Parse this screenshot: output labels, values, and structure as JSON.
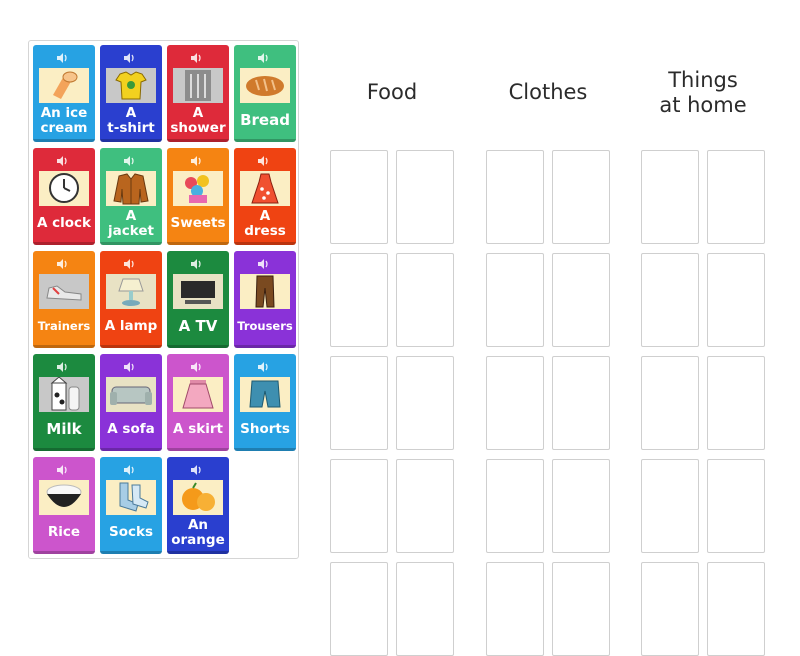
{
  "tray": {
    "cards": [
      {
        "label": "An ice\ncream",
        "color": "#27a2e3",
        "icon": "ice-cream-icon",
        "size": "normal"
      },
      {
        "label": "A\nt-shirt",
        "color": "#2a3fcf",
        "icon": "t-shirt-icon",
        "size": "normal"
      },
      {
        "label": "A\nshower",
        "color": "#de2a3a",
        "icon": "shower-icon",
        "size": "normal"
      },
      {
        "label": "Bread",
        "color": "#3fbf7f",
        "icon": "bread-icon",
        "size": "big"
      },
      {
        "label": "A clock",
        "color": "#de2a3a",
        "icon": "clock-icon",
        "size": "normal"
      },
      {
        "label": "A\njacket",
        "color": "#3fbf7f",
        "icon": "jacket-icon",
        "size": "normal"
      },
      {
        "label": "Sweets",
        "color": "#f58412",
        "icon": "sweets-icon",
        "size": "normal"
      },
      {
        "label": "A\ndress",
        "color": "#ef4312",
        "icon": "dress-icon",
        "size": "normal"
      },
      {
        "label": "Trainers",
        "color": "#f58412",
        "icon": "trainers-icon",
        "size": "small"
      },
      {
        "label": "A lamp",
        "color": "#ef4312",
        "icon": "lamp-icon",
        "size": "normal"
      },
      {
        "label": "A TV",
        "color": "#1c8a3f",
        "icon": "tv-icon",
        "size": "big"
      },
      {
        "label": "Trousers",
        "color": "#8a32d8",
        "icon": "trousers-icon",
        "size": "small"
      },
      {
        "label": "Milk",
        "color": "#1c8a3f",
        "icon": "milk-icon",
        "size": "big"
      },
      {
        "label": "A sofa",
        "color": "#8a32d8",
        "icon": "sofa-icon",
        "size": "normal"
      },
      {
        "label": "A skirt",
        "color": "#cc55cc",
        "icon": "skirt-icon",
        "size": "normal"
      },
      {
        "label": "Shorts",
        "color": "#27a2e3",
        "icon": "shorts-icon",
        "size": "normal"
      },
      {
        "label": "Rice",
        "color": "#cc55cc",
        "icon": "rice-icon",
        "size": "normal"
      },
      {
        "label": "Socks",
        "color": "#27a2e3",
        "icon": "socks-icon",
        "size": "normal"
      },
      {
        "label": "An\norange",
        "color": "#2a3fcf",
        "icon": "orange-icon",
        "size": "normal"
      }
    ],
    "speaker_icon": "speaker-icon"
  },
  "groups": [
    {
      "heading": "Food",
      "slots": 10
    },
    {
      "heading": "Clothes",
      "slots": 10
    },
    {
      "heading": "Things\nat home",
      "slots": 10
    }
  ]
}
